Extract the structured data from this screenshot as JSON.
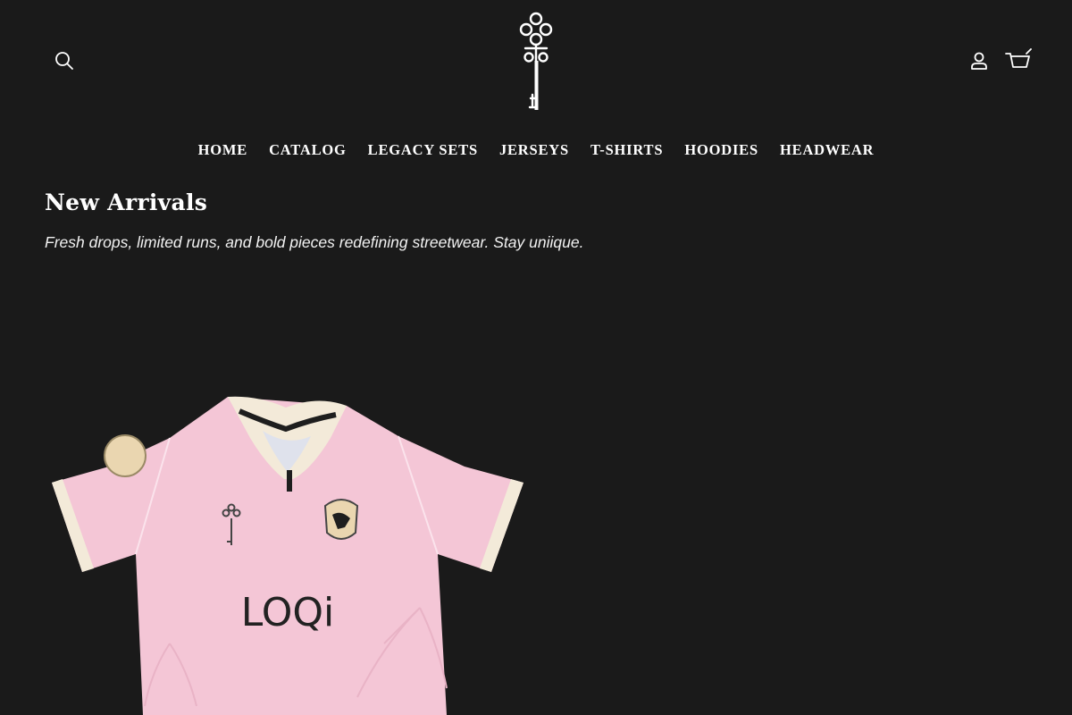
{
  "header": {
    "search_icon": "search-icon",
    "account_icon": "account-icon",
    "cart_icon": "cart-icon",
    "logo_icon": "key-logo-icon"
  },
  "nav": {
    "items": [
      "HOME",
      "CATALOG",
      "LEGACY SETS",
      "JERSEYS",
      "T-SHIRTS",
      "HOODIES",
      "HEADWEAR"
    ]
  },
  "collection": {
    "title": "New Arrivals",
    "description": "Fresh drops, limited runs, and bold pieces redefining streetwear. Stay uniique."
  },
  "product": {
    "image_brand_text": "LOQi",
    "jersey_color": "#f4c6d6",
    "trim_color": "#f3ead9"
  },
  "colors": {
    "background": "#1a1a1a",
    "text": "#ffffff"
  }
}
